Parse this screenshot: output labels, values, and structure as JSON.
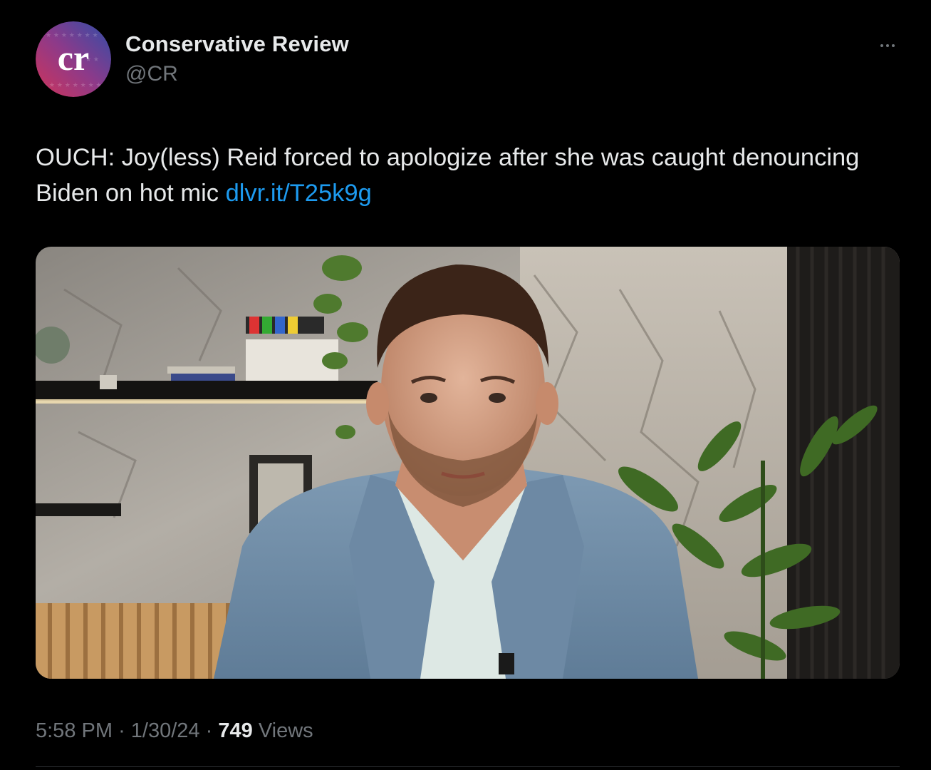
{
  "tweet": {
    "avatar_text": "cr",
    "display_name": "Conservative Review",
    "handle": "@CR",
    "text": "OUCH: Joy(less) Reid forced to apologize after she was caught denouncing Biden on hot mic ",
    "link_text": "dlvr.it/T25k9g",
    "time": "5:58 PM",
    "separator": "·",
    "date": "1/30/24",
    "views_count": "749",
    "views_label": "Views"
  },
  "icons": {
    "more": "more-options-icon",
    "avatar": "cr-logo-avatar"
  },
  "colors": {
    "background": "#000000",
    "primary_text": "#e7e9ea",
    "secondary_text": "#71767b",
    "link": "#1d9bf0",
    "divider": "#2f3336",
    "avatar_gradient_start": "#8c3a8a",
    "avatar_gradient_end": "#2f4ea8"
  }
}
